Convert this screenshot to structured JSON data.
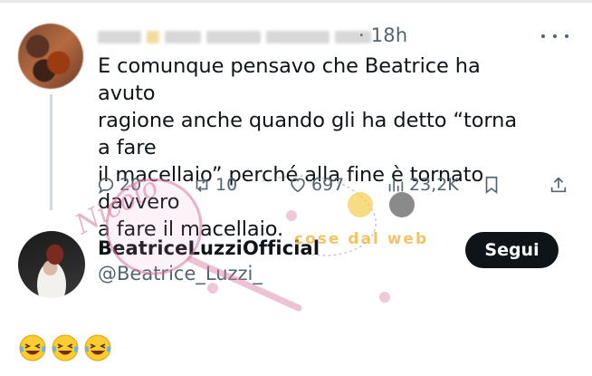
{
  "tweet": {
    "time": "· 18h",
    "text": "E comunque pensavo che Beatrice ha avuto\nragione anche quando gli ha detto “torna a fare\nil macellaio” perché alla fine è tornato davvero\na fare il macellaio.",
    "more_icon": "more-horizontal-icon",
    "actions": {
      "replies": "20",
      "retweets": "10",
      "likes": "697",
      "views": "23,2K"
    }
  },
  "profile": {
    "name": "BeatriceLuzziOfficial",
    "handle": "@Beatrice_Luzzi_",
    "follow_label": "Segui"
  },
  "emojis": [
    "😂",
    "😂",
    "😂"
  ],
  "watermark": {
    "script_text": "Nicolo",
    "site_text": "cose dal web"
  },
  "colors": {
    "text": "#0f1419",
    "secondary": "#536471",
    "button_bg": "#0f1419",
    "button_text": "#ffffff",
    "thread_line": "#cfd9de"
  }
}
